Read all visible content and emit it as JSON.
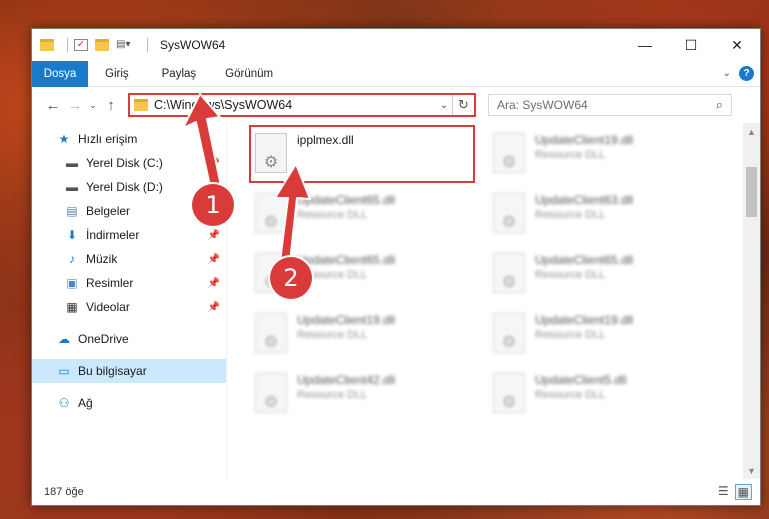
{
  "window": {
    "title": "SysWOW64",
    "controls": {
      "minimize": "—",
      "maximize": "☐",
      "close": "✕"
    }
  },
  "ribbon": {
    "tabs": [
      "Dosya",
      "Giriş",
      "Paylaş",
      "Görünüm"
    ],
    "help_label": "?"
  },
  "address": {
    "path": "C:\\Windows\\SysWOW64"
  },
  "search": {
    "placeholder": "Ara: SysWOW64"
  },
  "nav": {
    "items": [
      {
        "label": "Hızlı erişim",
        "icon": "star-icon"
      },
      {
        "label": "Yerel Disk (C:)",
        "icon": "drive-icon",
        "pinned": true
      },
      {
        "label": "Yerel Disk (D:)",
        "icon": "drive-icon",
        "pinned": true
      },
      {
        "label": "Belgeler",
        "icon": "documents-icon",
        "pinned": true
      },
      {
        "label": "İndirmeler",
        "icon": "download-icon",
        "pinned": true
      },
      {
        "label": "Müzik",
        "icon": "music-icon",
        "pinned": true
      },
      {
        "label": "Resimler",
        "icon": "pictures-icon",
        "pinned": true
      },
      {
        "label": "Videolar",
        "icon": "videos-icon",
        "pinned": true
      },
      {
        "label": "OneDrive",
        "icon": "cloud-icon"
      },
      {
        "label": "Bu bilgisayar",
        "icon": "computer-icon"
      },
      {
        "label": "Ağ",
        "icon": "network-icon"
      }
    ]
  },
  "files": [
    {
      "name": "ipplmex.dll",
      "type": ""
    },
    {
      "name": "UpdateClient19.dll",
      "type": "Resource DLL"
    },
    {
      "name": "UpdateClient65.dll",
      "type": "Resource DLL"
    },
    {
      "name": "UpdateClient63.dll",
      "type": "Resource DLL"
    },
    {
      "name": "UpdateClient65.dll",
      "type": "Resource DLL"
    },
    {
      "name": "UpdateClient65.dll",
      "type": "Resource DLL"
    },
    {
      "name": "UpdateClient19.dll",
      "type": "Resource DLL"
    },
    {
      "name": "UpdateClient19.dll",
      "type": "Resource DLL"
    },
    {
      "name": "UpdateClient42.dll",
      "type": "Resource DLL"
    },
    {
      "name": "UpdateClient5.dll",
      "type": "Resource DLL"
    }
  ],
  "status": {
    "count": "187 öğe"
  },
  "annotations": {
    "step1": "1",
    "step2": "2"
  },
  "colors": {
    "accent": "#1979ca",
    "highlight": "#d93a3a",
    "selected": "#cce8ff"
  }
}
